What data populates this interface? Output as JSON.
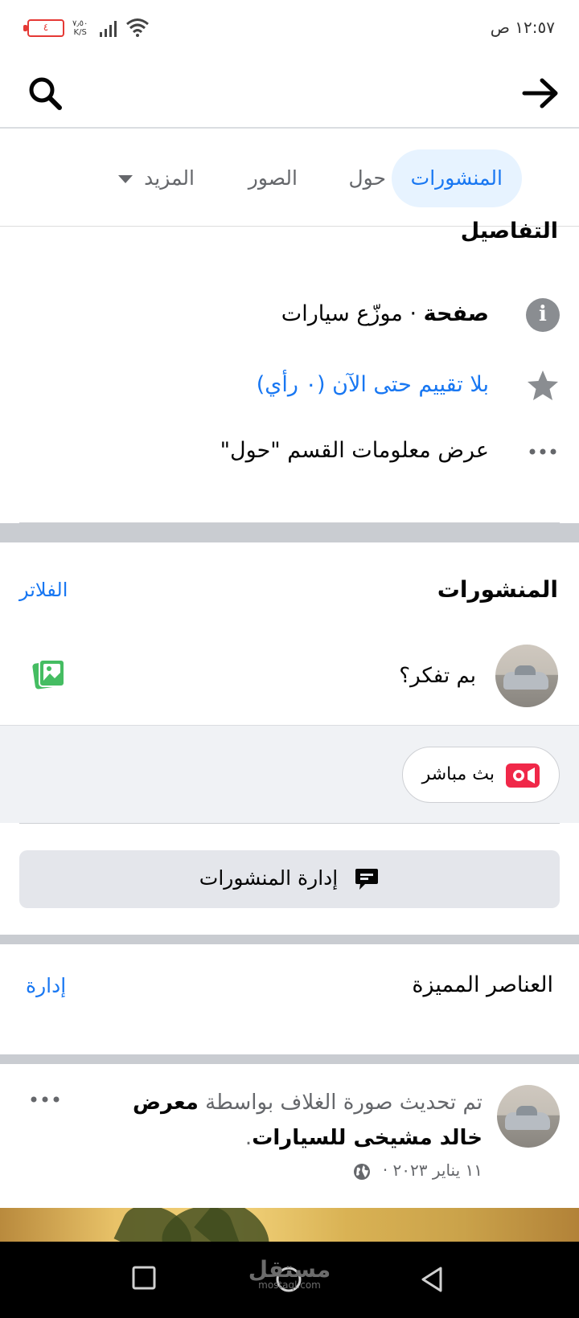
{
  "status_bar": {
    "time": "١٢:٥٧ ص",
    "battery": "٤",
    "net_speed": "٧٫٥٠",
    "net_unit": "K/S"
  },
  "tabs": [
    {
      "label": "المنشورات",
      "active": true
    },
    {
      "label": "حول"
    },
    {
      "label": "الصور"
    },
    {
      "label": "المزيد"
    }
  ],
  "details": {
    "title": "التفاصيل",
    "type_bold": "صفحة",
    "type_rest": " · موزّع سيارات",
    "rating": "بلا تقييم حتى الآن (٠ رأي)",
    "see_about": "عرض معلومات القسم \"حول\""
  },
  "posts": {
    "title": "المنشورات",
    "filters": "الفلاتر",
    "composer_placeholder": "بم تفكر؟",
    "live_label": "بث مباشر",
    "manage_posts": "إدارة المنشورات"
  },
  "featured": {
    "title": "العناصر المميزة",
    "manage": "إدارة"
  },
  "post": {
    "text_prefix": "تم تحديث صورة الغلاف بواسطة ",
    "author": "معرض خالد مشيخى للسيارات",
    "text_suffix": ".",
    "date": "١١ يناير ٢٠٢٣ ·"
  },
  "watermark": {
    "name": "مستقل",
    "domain": "mostaql.com"
  },
  "colors": {
    "accent": "#1877f2",
    "tab_active_bg": "#e7f3ff",
    "separator": "#c9ccd1",
    "live_red": "#f02849",
    "photo_green": "#45bd62"
  }
}
